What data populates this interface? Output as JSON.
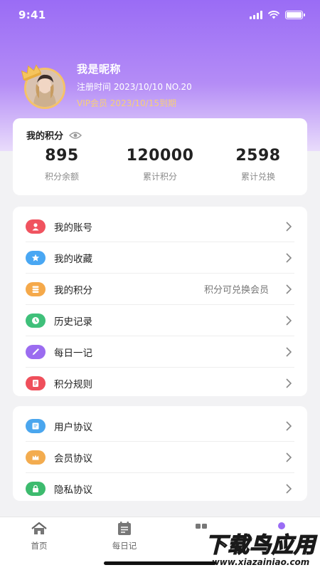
{
  "status": {
    "time": "9:41"
  },
  "profile": {
    "nickname": "我是昵称",
    "register": "注册时间 2023/10/10 NO.20",
    "vip": "VIP会员 2023/10/15到期"
  },
  "points": {
    "title": "我的积分",
    "stats": [
      {
        "value": "895",
        "label": "积分余额"
      },
      {
        "value": "120000",
        "label": "累计积分"
      },
      {
        "value": "2598",
        "label": "累计兑换"
      }
    ]
  },
  "menu1": [
    {
      "label": "我的账号",
      "icon": "user-icon",
      "color": "#f0535f",
      "extra": ""
    },
    {
      "label": "我的收藏",
      "icon": "star-icon",
      "color": "#49a7f3",
      "extra": ""
    },
    {
      "label": "我的积分",
      "icon": "coins-icon",
      "color": "#f5a94a",
      "extra": "积分可兑换会员"
    },
    {
      "label": "历史记录",
      "icon": "clock-icon",
      "color": "#3fc07a",
      "extra": ""
    },
    {
      "label": "每日一记",
      "icon": "pen-icon",
      "color": "#9b6cf0",
      "extra": ""
    },
    {
      "label": "积分规则",
      "icon": "rules-icon",
      "color": "#ef4f5b",
      "extra": ""
    }
  ],
  "menu2": [
    {
      "label": "用户协议",
      "icon": "document-icon",
      "color": "#4aa6ee"
    },
    {
      "label": "会员协议",
      "icon": "crown-icon",
      "color": "#f3ac4f"
    },
    {
      "label": "隐私协议",
      "icon": "lock-icon",
      "color": "#3dbb6e"
    }
  ],
  "tabs": [
    {
      "label": "首页",
      "icon": "home-icon"
    },
    {
      "label": "每日记",
      "icon": "diary-icon"
    }
  ],
  "watermark": {
    "big": "下载鸟应用",
    "small": "www.xiazainiao.com"
  }
}
